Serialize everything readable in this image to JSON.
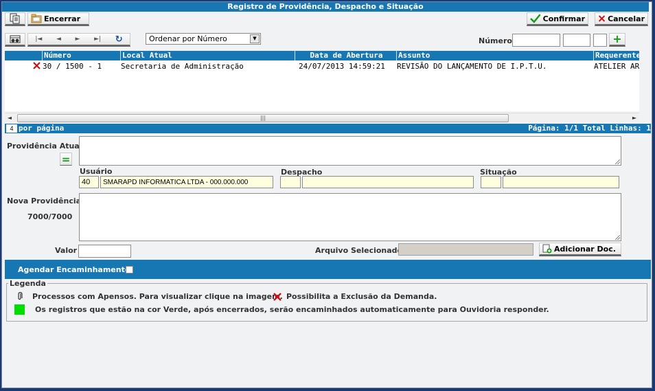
{
  "window": {
    "title": "Registro de Providência, Despacho e Situação"
  },
  "toolbar": {
    "close_label": "Encerrar",
    "confirm_label": "Confirmar",
    "cancel_label": "Cancelar"
  },
  "navigation": {
    "order_select_value": "Ordenar por Número",
    "numero_label": "Número",
    "numero_value_1": "",
    "numero_value_2": "",
    "numero_value_3": "",
    "add_symbol": "+"
  },
  "grid": {
    "columns": [
      "Número",
      "Local Atual",
      "Data de Abertura",
      "Assunto",
      "Requerente"
    ],
    "rows": [
      {
        "numero": "30 / 1500 - 1",
        "local_atual": "Secretaria de Administração",
        "data_abertura": "24/07/2013 14:59:21",
        "assunto": "REVISÃO DO LANÇAMENTO DE I.P.T.U.",
        "requerente": "ATELIER AR"
      }
    ]
  },
  "pager": {
    "per_page_value": "4",
    "per_page_label": "por página",
    "status_text": "Página: 1/1 Total Linhas: 1"
  },
  "form": {
    "providencia_atual_label": "Providência Atual",
    "equal_symbol": "=",
    "usuario_label": "Usuário",
    "usuario_code": "40",
    "usuario_name": "SMARAPD INFORMATICA LTDA - 000.000.000",
    "despacho_label": "Despacho",
    "despacho_code": "",
    "despacho_desc": "",
    "situacao_label": "Situação",
    "situacao_code": "",
    "situacao_desc": "",
    "nova_providencia_label": "Nova Providência",
    "char_counter": "7000/7000",
    "valor_label": "Valor",
    "valor_value": "",
    "arquivo_label": "Arquivo Selecionado",
    "arquivo_value": "",
    "add_doc_label": "Adicionar Doc."
  },
  "agendar": {
    "label": "Agendar Encaminhamento"
  },
  "legend": {
    "title": "Legenda",
    "item_attachments": "Processos com Apensos. Para visualizar clique na imagem.",
    "item_delete": "Possibilita a Exclusão da Demanda.",
    "item_green": "Os registros que estão na cor Verde, após encerrados, serão encaminhados automaticamente para Ouvidoria responder."
  },
  "colors": {
    "accent_blue": "#1677b3",
    "delete_red": "#cc1111",
    "confirm_green": "#1a9a1a",
    "legend_green": "#00dd00"
  }
}
